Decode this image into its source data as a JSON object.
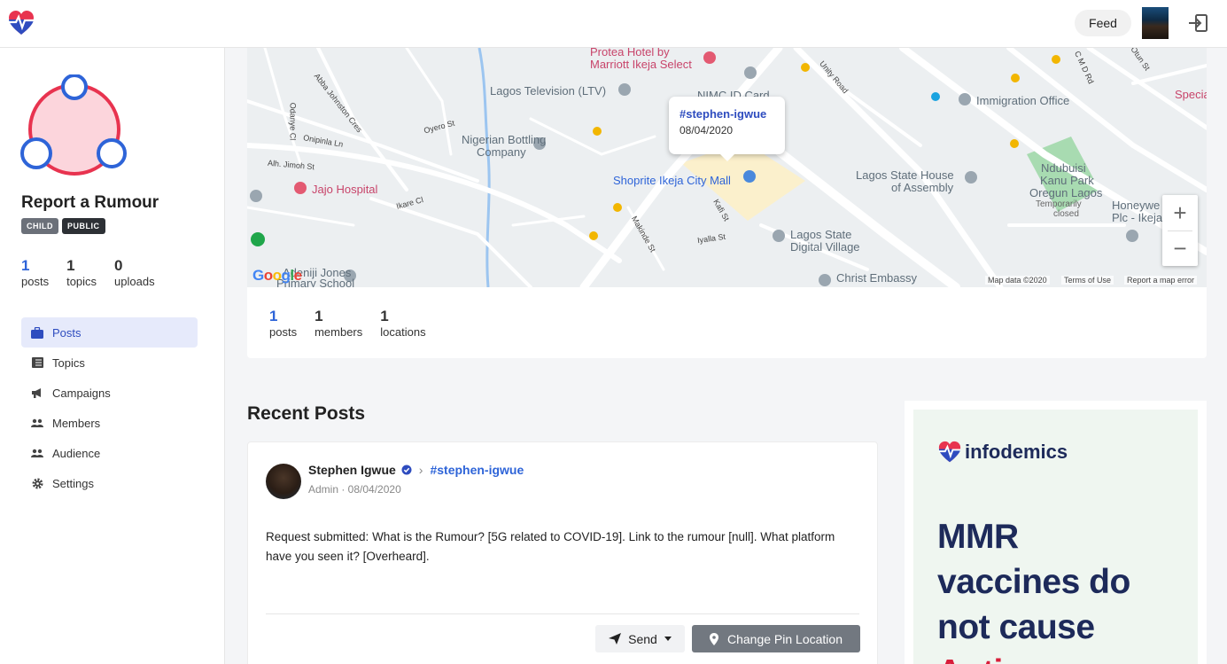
{
  "topbar": {
    "feed_label": "Feed",
    "logo_icon": "heartbeat-logo-icon",
    "avatar": "user-avatar",
    "logout_icon": "logout-icon"
  },
  "sidebar": {
    "group_title": "Report a Rumour",
    "badges": [
      "CHILD",
      "PUBLIC"
    ],
    "stats": [
      {
        "value": "1",
        "label": "posts"
      },
      {
        "value": "1",
        "label": "topics"
      },
      {
        "value": "0",
        "label": "uploads"
      }
    ],
    "nav": [
      {
        "label": "Posts",
        "icon": "briefcase-icon",
        "active": true
      },
      {
        "label": "Topics",
        "icon": "list-icon",
        "active": false
      },
      {
        "label": "Campaigns",
        "icon": "megaphone-icon",
        "active": false
      },
      {
        "label": "Members",
        "icon": "users-icon",
        "active": false
      },
      {
        "label": "Audience",
        "icon": "users-icon",
        "active": false
      },
      {
        "label": "Settings",
        "icon": "gear-icon",
        "active": false
      }
    ]
  },
  "map": {
    "popup": {
      "tag": "#stephen-igwue",
      "date": "08/04/2020"
    },
    "labels": {
      "protea": "Protea Hotel by",
      "marriott": "Marriott Ikeja Select",
      "ltv": "Lagos Television (LTV)",
      "nimc": "NIMC ID Card",
      "immigration": "Immigration Office",
      "special": "Specia",
      "nbc1": "Nigerian Bottling",
      "nbc2": "Company",
      "shoprite": "Shoprite Ikeja City Mall",
      "house1": "Lagos State House",
      "house2": "of Assembly",
      "park1": "Ndubuisi",
      "park2": "Kanu Park",
      "park3": "Oregun Lagos",
      "park4": "Temporarily",
      "park5": "closed",
      "jajo": "Jajo Hospital",
      "digital1": "Lagos State",
      "digital2": "Digital Village",
      "christ": "Christ Embassy",
      "honey1": "Honeywe",
      "honey2": "Plc - Ikeja",
      "adeniji1": "Adeniji Jones",
      "adeniji2": "Primary School",
      "unity": "Unity Road",
      "oyero": "Oyero St",
      "onipinla": "Onipinla Ln",
      "jimoh": "Alh. Jimoh St",
      "ikare": "Ikare Cl",
      "makinde": "Makinde St",
      "iyalla": "Iyalla St",
      "kafi": "Kafi St",
      "abba": "Abba Johnston Cres",
      "odanye": "Odanye Cl",
      "cmd": "C M D Rd",
      "otun": "Otun St"
    },
    "google": "Google",
    "attribution": [
      "Map data ©2020",
      "Terms of Use",
      "Report a map error"
    ],
    "stats": [
      {
        "value": "1",
        "label": "posts"
      },
      {
        "value": "1",
        "label": "members"
      },
      {
        "value": "1",
        "label": "locations"
      }
    ]
  },
  "recent": {
    "title": "Recent Posts",
    "post": {
      "author": "Stephen Igwue",
      "hashtag": "#stephen-igwue",
      "meta": "Admin · 08/04/2020",
      "body": "Request submitted: What is the Rumour? [5G related to COVID-19]. Link to the rumour [null]. What platform have you seen it? [Overheard].",
      "send_label": "Send",
      "pin_label": "Change Pin Location"
    }
  },
  "ad": {
    "brand": "infodemics",
    "line1": "MMR",
    "line2": "vaccines do",
    "line3": "not cause",
    "line4": "Autism"
  },
  "colors": {
    "accent": "#2e64d8",
    "brand_red": "#e8334f",
    "brand_navy": "#1d2a5a"
  }
}
